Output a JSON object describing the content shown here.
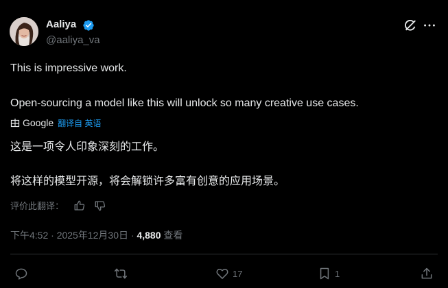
{
  "author": {
    "name": "Aaliya",
    "handle": "@aaliya_va"
  },
  "post": {
    "line1": "This is impressive work.",
    "line2": "Open-sourcing a model like this will unlock so many creative use cases."
  },
  "translation": {
    "provider": "Google",
    "label": "翻译自 英语",
    "line1": "这是一项令人印象深刻的工作。",
    "line2": "将这样的模型开源，将会解锁许多富有创意的应用场景。",
    "rate_label": "评价此翻译："
  },
  "meta": {
    "time": "下午4:52",
    "sep1": " · ",
    "date": "2025年12月30日",
    "sep2": " · ",
    "views": "4,880",
    "views_label": " 查看"
  },
  "actions": {
    "likes": "17",
    "bookmarks": "1"
  },
  "colors": {
    "accent": "#1d9bf0",
    "muted": "#71767b",
    "text": "#e7e9ea",
    "background": "#000000"
  },
  "icons": [
    "verified-badge-icon",
    "grok-icon",
    "more-icon",
    "google-logo-icon",
    "thumbs-up-icon",
    "thumbs-down-icon",
    "reply-icon",
    "repost-icon",
    "like-icon",
    "bookmark-icon",
    "share-icon"
  ]
}
